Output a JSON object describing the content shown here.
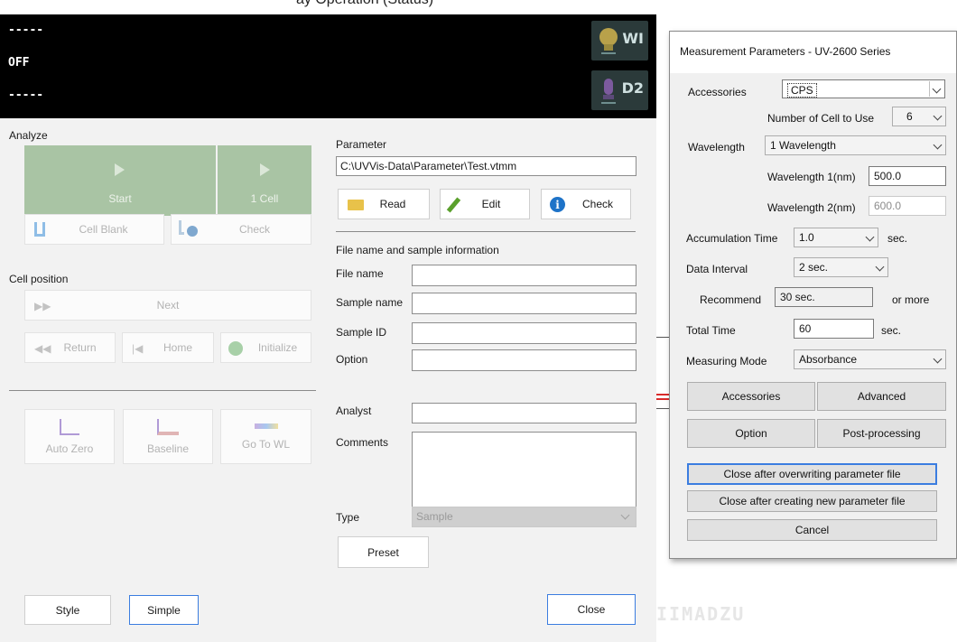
{
  "top_title_fragment": "ay Operation (Status)",
  "status": {
    "line1": "-----",
    "line2": "OFF",
    "line3": "-----",
    "lamp_wi": "WI",
    "lamp_d2": "D2"
  },
  "analyze": {
    "label": "Analyze",
    "start": "Start",
    "cell_count": "1 Cell",
    "cell_blank": "Cell Blank",
    "check": "Check"
  },
  "cell_position": {
    "label": "Cell position",
    "next": "Next",
    "return": "Return",
    "home": "Home",
    "initialize": "Initialize"
  },
  "tools": {
    "auto_zero": "Auto Zero",
    "baseline": "Baseline",
    "go_to_wl": "Go To WL"
  },
  "parameter": {
    "label": "Parameter",
    "path": "C:\\UVVis-Data\\Parameter\\Test.vtmm",
    "read": "Read",
    "edit": "Edit",
    "check": "Check"
  },
  "file_info": {
    "header": "File name and sample information",
    "file_name_label": "File name",
    "sample_name_label": "Sample name",
    "sample_id_label": "Sample ID",
    "option_label": "Option",
    "analyst_label": "Analyst",
    "comments_label": "Comments",
    "type_label": "Type",
    "type_value": "Sample",
    "preset": "Preset"
  },
  "footer": {
    "style": "Style",
    "simple": "Simple",
    "close": "Close"
  },
  "brand_fragment": "IIMADZU",
  "mp": {
    "title": "Measurement Parameters - UV-2600 Series",
    "accessories_label": "Accessories",
    "accessories_value": "CPS",
    "num_cell_label": "Number of Cell to Use",
    "num_cell_value": "6",
    "wavelength_label": "Wavelength",
    "wavelength_value": "1 Wavelength",
    "wl1_label": "Wavelength 1(nm)",
    "wl1_value": "500.0",
    "wl2_label": "Wavelength 2(nm)",
    "wl2_value": "600.0",
    "accum_label": "Accumulation Time",
    "accum_value": "1.0",
    "accum_unit": "sec.",
    "interval_label": "Data Interval",
    "interval_value": "2 sec.",
    "recommend_label": "Recommend",
    "recommend_value": "30 sec.",
    "recommend_suffix": "or more",
    "total_label": "Total Time",
    "total_value": "60",
    "total_unit": "sec.",
    "mode_label": "Measuring Mode",
    "mode_value": "Absorbance",
    "btn_accessories": "Accessories",
    "btn_advanced": "Advanced",
    "btn_option": "Option",
    "btn_post": "Post-processing",
    "btn_overwrite": "Close after overwriting parameter file",
    "btn_create": "Close after creating new parameter file",
    "btn_cancel": "Cancel"
  },
  "colors": {
    "status_bg": "#000000",
    "start_green": "#a9c4a4",
    "focus_blue": "#3b7de0",
    "graph_red": "#d92b2b"
  }
}
